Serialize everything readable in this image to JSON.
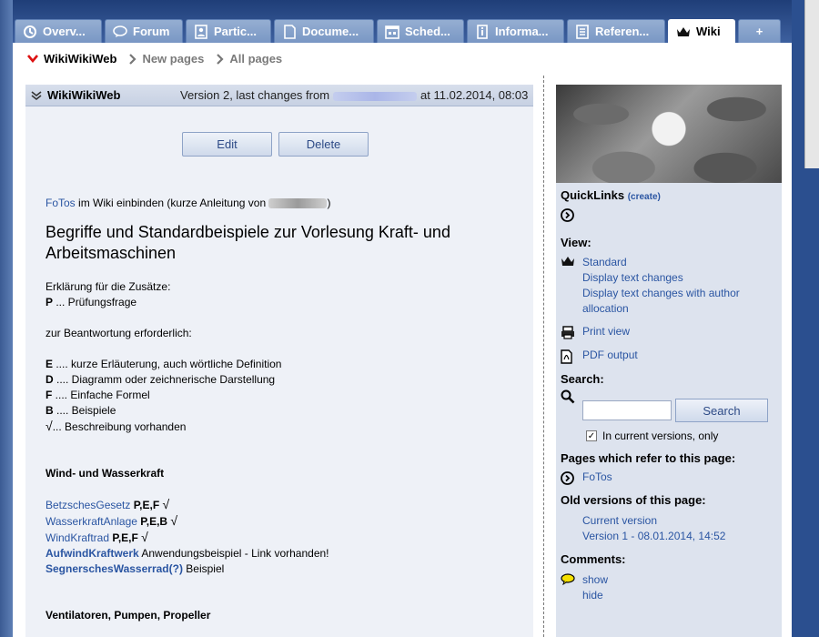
{
  "tabs": [
    {
      "label": "Overv...",
      "icon": "overview-icon"
    },
    {
      "label": "Forum",
      "icon": "speech-bubble-icon"
    },
    {
      "label": "Partic...",
      "icon": "participants-icon"
    },
    {
      "label": "Docume...",
      "icon": "document-icon"
    },
    {
      "label": "Sched...",
      "icon": "calendar-icon"
    },
    {
      "label": "Informa...",
      "icon": "info-icon"
    },
    {
      "label": "Referen...",
      "icon": "reference-icon"
    },
    {
      "label": "Wiki",
      "icon": "wiki-crown-icon",
      "active": true
    },
    {
      "label": "+",
      "icon": "plus"
    }
  ],
  "breadcrumb": {
    "current": "WikiWikiWeb",
    "new_pages": "New pages",
    "all_pages": "All pages"
  },
  "page_header": {
    "title": "WikiWikiWeb",
    "version_text": "Version 2, last changes from",
    "date_text": "at 11.02.2014, 08:03"
  },
  "actions": {
    "edit": "Edit",
    "delete": "Delete"
  },
  "wiki": {
    "intro_link": "FoTos",
    "intro_text": " im Wiki einbinden (kurze Anleitung von ",
    "intro_close": ")",
    "heading": "Begriffe und Standardbeispiele zur Vorlesung Kraft- und Arbeitsmaschinen",
    "explain_title": "Erklärung für die Zusätze:",
    "p_key": "P",
    "p_text": " ... Prüfungsfrage",
    "answer_needed": "zur Beantwortung erforderlich:",
    "legend": [
      {
        "key": "E",
        "text": " .... kurze Erläuterung, auch wörtliche Definition"
      },
      {
        "key": "D",
        "text": " .... Diagramm oder zeichnerische Darstellung"
      },
      {
        "key": "F",
        "text": " .... Einfache Formel"
      },
      {
        "key": "B",
        "text": " .... Beispiele"
      },
      {
        "key": "√",
        "text": "... Beschreibung vorhanden"
      }
    ],
    "section1": "Wind- und Wasserkraft",
    "entries": [
      {
        "link": "BetzschesGesetz",
        "tags": " P,E,F ",
        "check": "√"
      },
      {
        "link": "WasserkraftAnlage",
        "tags": " P,E,B ",
        "check": "√"
      },
      {
        "link": "WindKraftrad",
        "tags": " P,E,F ",
        "check": "√"
      }
    ],
    "aufwind_link": "AufwindKraftwerk",
    "aufwind_text": " Anwendungsbeispiel - Link vorhanden!",
    "segner_link": "SegnerschesWasserrad(?)",
    "segner_text": " Beispiel",
    "section2": "Ventilatoren, Pumpen, Propeller"
  },
  "sidebar": {
    "quicklinks_title": "QuickLinks",
    "quicklinks_create": "(create)",
    "view_title": "View:",
    "view_links": [
      "Standard",
      "Display text changes",
      "Display text changes with author allocation"
    ],
    "print_view": "Print view",
    "pdf_output": "PDF output",
    "search_title": "Search:",
    "search_value": "",
    "search_button": "Search",
    "current_only": "In current versions, only",
    "refer_title": "Pages which refer to this page:",
    "refer_link": "FoTos",
    "old_versions_title": "Old versions of this page:",
    "current_version": "Current version",
    "version1": "Version 1 - 08.01.2014, 14:52",
    "comments_title": "Comments:",
    "show": "show",
    "hide": "hide"
  }
}
